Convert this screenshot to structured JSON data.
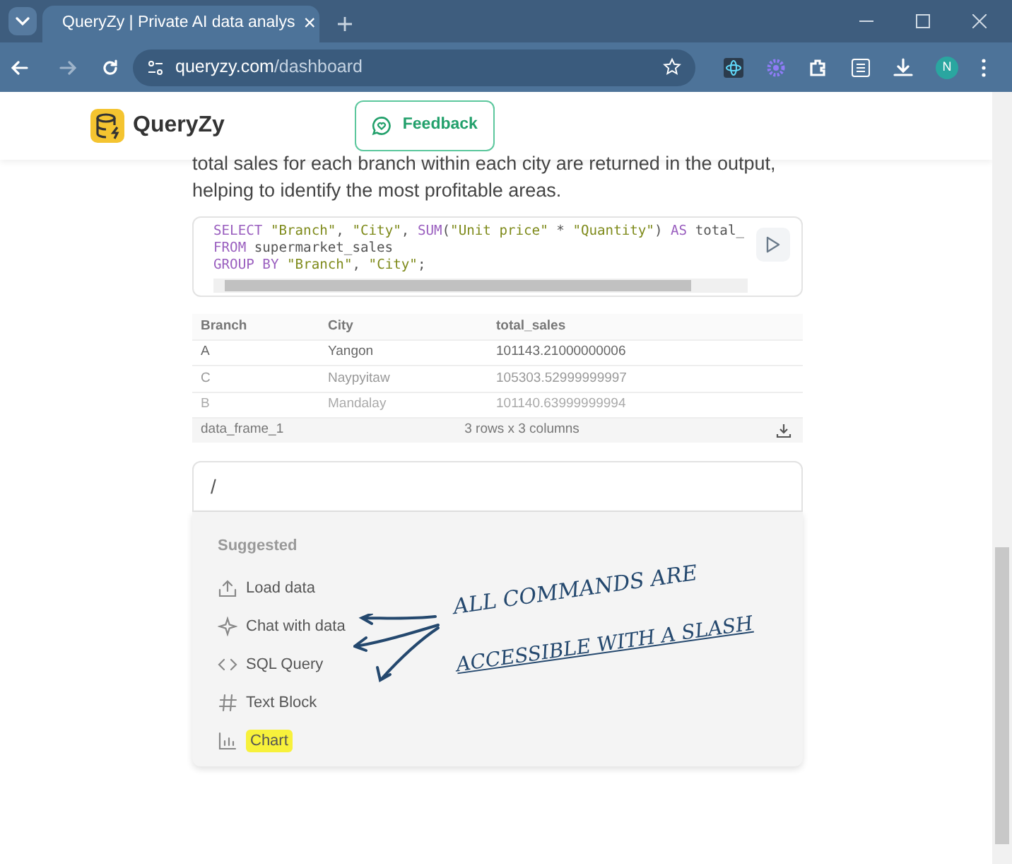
{
  "browser": {
    "tab_title": "QueryZy | Private AI data analys",
    "url_host": "queryzy.com",
    "url_path": "/dashboard",
    "tab_close": "×",
    "profile_initial": "N"
  },
  "header": {
    "brand": "QueryZy",
    "feedback_button": "Feedback"
  },
  "paragraph": "total sales for each branch within each city are returned in the output, helping to identify the most profitable areas.",
  "code_lines": [
    "SELECT \"Branch\", \"City\", SUM(\"Unit price\" * \"Quantity\") AS total_",
    "FROM supermarket_sales",
    "GROUP BY \"Branch\", \"City\";"
  ],
  "table": {
    "columns": [
      "Branch",
      "City",
      "total_sales"
    ],
    "rows": [
      [
        "A",
        "Yangon",
        "101143.21000000006"
      ],
      [
        "C",
        "Naypyitaw",
        "105303.52999999997"
      ],
      [
        "B",
        "Mandalay",
        "101140.63999999994"
      ]
    ],
    "frame_name": "data_frame_1",
    "summary": "3 rows x 3 columns"
  },
  "command_input": {
    "value": "/"
  },
  "menu": {
    "heading": "Suggested",
    "items": [
      {
        "label": "Load data",
        "kind": "upload",
        "highlighted": false
      },
      {
        "label": "Chat with data",
        "kind": "chat",
        "highlighted": false
      },
      {
        "label": "SQL Query",
        "kind": "sql",
        "highlighted": false
      },
      {
        "label": "Text Block",
        "kind": "text",
        "highlighted": false
      },
      {
        "label": "Chart",
        "kind": "chart",
        "highlighted": true
      }
    ]
  },
  "annotation": [
    "ALL COMMANDS ARE",
    "ACCESSIBLE WITH A SLASH"
  ]
}
